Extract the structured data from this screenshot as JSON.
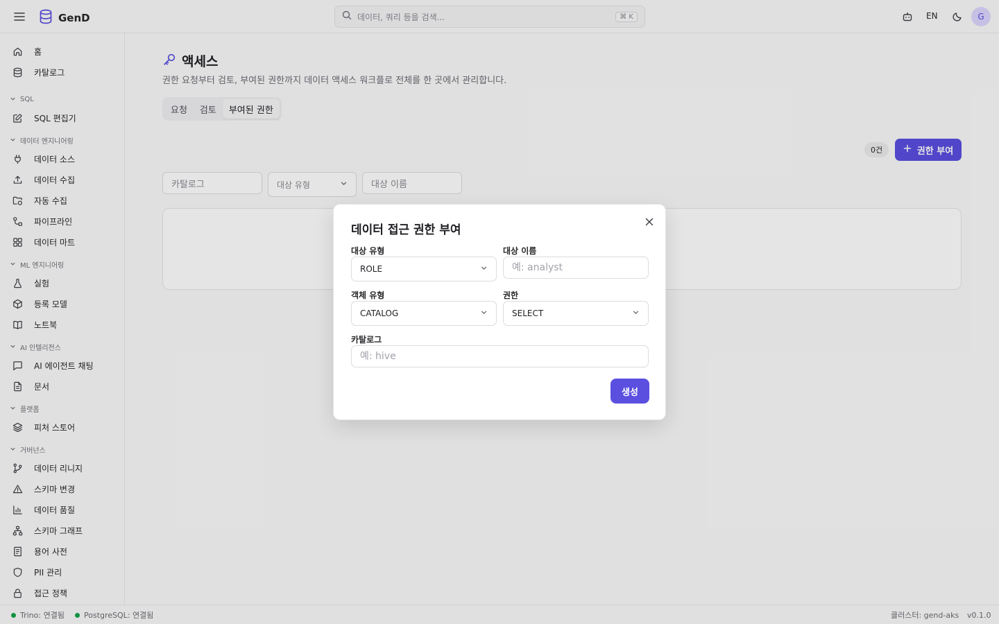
{
  "app": {
    "name": "GenD"
  },
  "header": {
    "search_placeholder": "데이터, 쿼리 등을 검색...",
    "search_shortcut": "⌘ K",
    "language": "EN",
    "avatar_initial": "G"
  },
  "sidebar": {
    "home": "홈",
    "catalog": "카탈로그",
    "sec_sql": "SQL",
    "sql_editor": "SQL 편집기",
    "sec_data_eng": "데이터 엔지니어링",
    "data_sources": "데이터 소스",
    "data_ingest": "데이터 수집",
    "auto_ingest": "자동 수집",
    "pipelines": "파이프라인",
    "data_mart": "데이터 마트",
    "sec_ml": "ML 엔지니어링",
    "experiments": "실험",
    "registered_models": "등록 모델",
    "notebooks": "노트북",
    "sec_ai": "AI 인텔리전스",
    "ai_agent_chat": "AI 에이전트 채팅",
    "documents": "문서",
    "sec_platform": "플랫폼",
    "feature_store": "피처 스토어",
    "sec_governance": "거버넌스",
    "data_lineage": "데이터 리니지",
    "schema_changes": "스키마 변경",
    "data_quality": "데이터 품질",
    "schema_graph": "스키마 그래프",
    "glossary": "용어 사전",
    "pii": "PII 관리",
    "access_policy": "접근 정책"
  },
  "main": {
    "title": "액세스",
    "description": "권한 요청부터 검토, 부여된 권한까지 데이터 액세스 워크플로 전체를 한 곳에서 관리합니다.",
    "tabs": [
      {
        "label": "요청"
      },
      {
        "label": "검토"
      },
      {
        "label": "부여된 권한"
      }
    ],
    "count_badge": "0건",
    "grant_button": "권한 부여",
    "filters": {
      "catalog_placeholder": "카탈로그",
      "target_type_placeholder": "대상 유형",
      "target_name_placeholder": "대상 이름"
    }
  },
  "dialog": {
    "title": "데이터 접근 권한 부여",
    "target_type_label": "대상 유형",
    "target_type_value": "ROLE",
    "target_name_label": "대상 이름",
    "target_name_placeholder": "예: analyst",
    "object_type_label": "객체 유형",
    "object_type_value": "CATALOG",
    "privilege_label": "권한",
    "privilege_value": "SELECT",
    "catalog_label": "카탈로그",
    "catalog_placeholder": "예: hive",
    "create_button": "생성"
  },
  "footer": {
    "trino_status": "Trino: 연결됨",
    "postgres_status": "PostgreSQL: 연결됨",
    "cluster": "클러스터: gend-aks",
    "version": "v0.1.0"
  },
  "colors": {
    "accent": "#5b4fe0",
    "status_ok": "#16a34a"
  }
}
